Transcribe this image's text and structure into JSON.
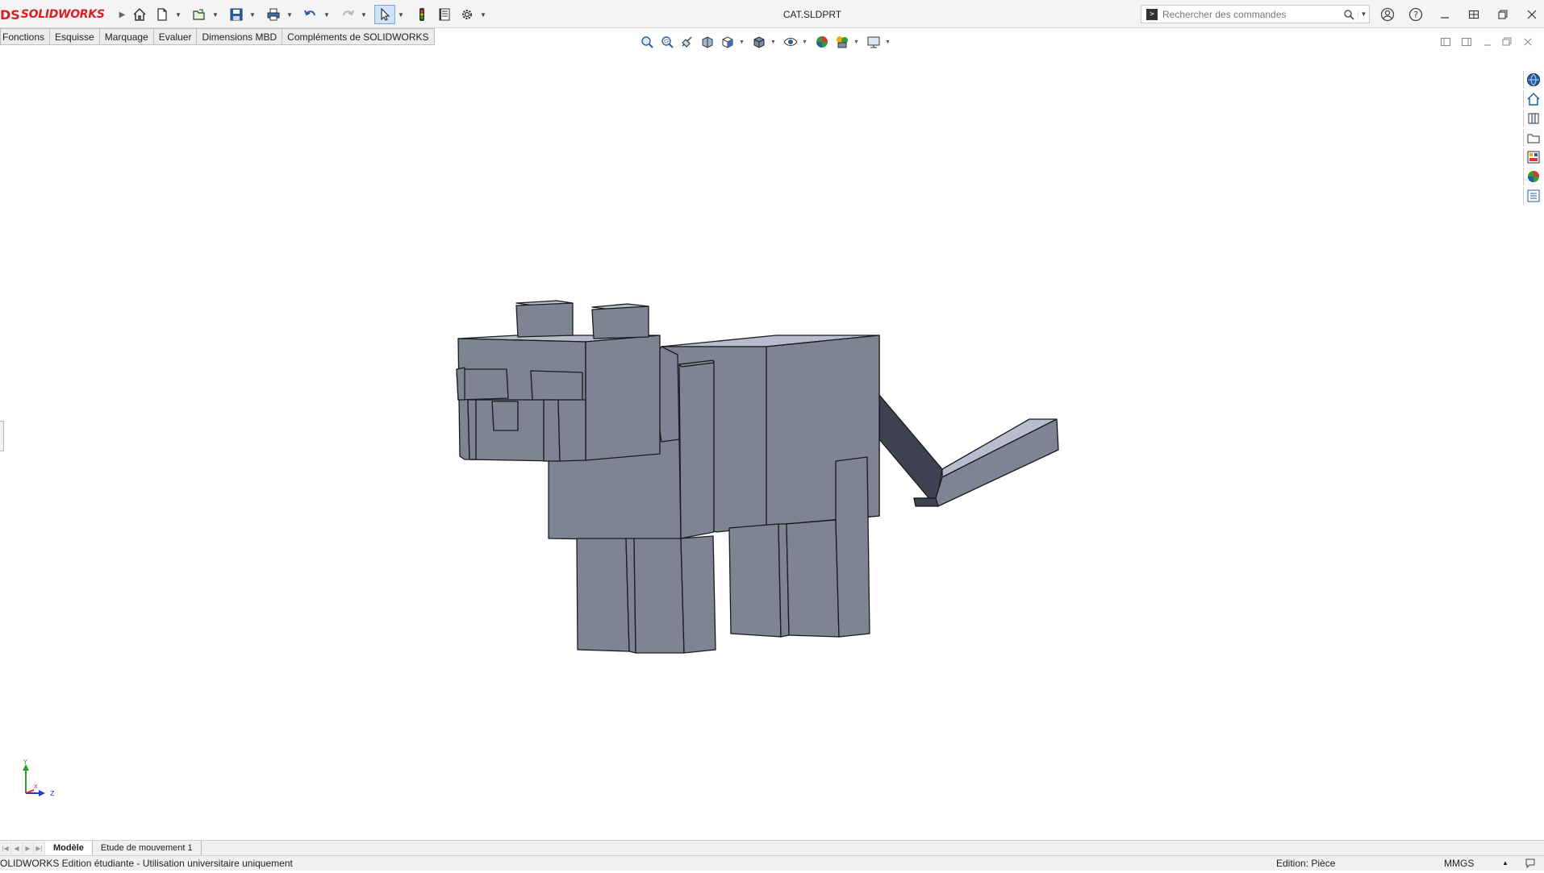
{
  "app": {
    "logo_prefix": "DS",
    "logo_brand": "SOLIDWORKS",
    "document_title": "CAT.SLDPRT"
  },
  "search": {
    "placeholder": "Rechercher des commandes"
  },
  "menubar": {
    "items": [
      {
        "label": "Fonctions"
      },
      {
        "label": "Esquisse"
      },
      {
        "label": "Marquage"
      },
      {
        "label": "Evaluer"
      },
      {
        "label": "Dimensions MBD"
      },
      {
        "label": "Compléments de SOLIDWORKS"
      }
    ]
  },
  "triad": {
    "y_label": "Y",
    "z_label": "Z",
    "x_label": "X"
  },
  "tabs": {
    "items": [
      {
        "label": "Modèle",
        "active": true
      },
      {
        "label": "Etude de mouvement 1",
        "active": false
      }
    ]
  },
  "status": {
    "left_text": "OLIDWORKS Edition étudiante - Utilisation universitaire uniquement",
    "mode": "Edition: Pièce",
    "units": "MMGS"
  },
  "colors": {
    "accent": "#d71f26",
    "model_face": "#7f8494",
    "model_top": "#b9bccc",
    "model_dark": "#3e4150",
    "edge": "#1a1a1a"
  }
}
